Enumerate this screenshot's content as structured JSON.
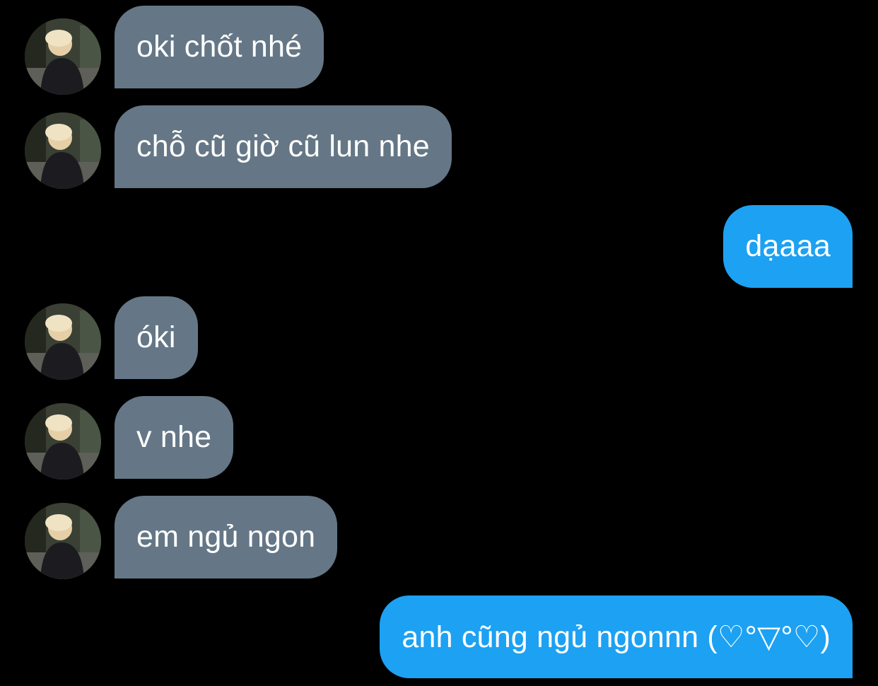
{
  "colors": {
    "background": "#000000",
    "incoming_bubble": "#657786",
    "outgoing_bubble": "#1da1f2",
    "text": "#ffffff"
  },
  "messages": [
    {
      "direction": "incoming",
      "text": "oki chốt nhé",
      "avatar": "user-avatar-photo"
    },
    {
      "direction": "incoming",
      "text": "chỗ cũ giờ cũ lun nhe",
      "avatar": "user-avatar-photo"
    },
    {
      "direction": "outgoing",
      "text": "dạaaa"
    },
    {
      "direction": "incoming",
      "text": "óki",
      "avatar": "user-avatar-photo"
    },
    {
      "direction": "incoming",
      "text": "v nhe",
      "avatar": "user-avatar-photo"
    },
    {
      "direction": "incoming",
      "text": "em ngủ ngon",
      "avatar": "user-avatar-photo"
    },
    {
      "direction": "outgoing",
      "text": "anh cũng ngủ ngonnn (♡°▽°♡)"
    }
  ]
}
